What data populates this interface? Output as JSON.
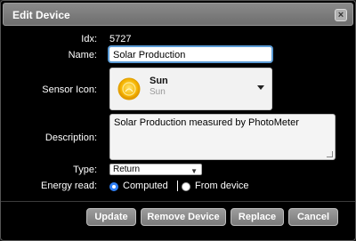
{
  "dialog": {
    "title": "Edit Device",
    "close_label": "×"
  },
  "form": {
    "idx_label": "Idx:",
    "idx_value": "5727",
    "name_label": "Name:",
    "name_value": "Solar Production",
    "sensor_icon_label": "Sensor Icon:",
    "sensor_icon": {
      "title": "Sun",
      "subtitle": "Sun",
      "icon": "sun-icon"
    },
    "description_label": "Description:",
    "description_value": "Solar Production measured by PhotoMeter",
    "type_label": "Type:",
    "type_value": "Return",
    "energy_read_label": "Energy read:",
    "energy_options": [
      {
        "label": "Computed",
        "selected": true
      },
      {
        "label": "From device",
        "selected": false
      }
    ]
  },
  "buttons": {
    "update": "Update",
    "remove": "Remove Device",
    "replace": "Replace",
    "cancel": "Cancel"
  },
  "colors": {
    "accent": "#2f7ff5",
    "focus_border": "#5b9bd5",
    "background": "#000000",
    "titlebar": "#7a7a7a"
  }
}
